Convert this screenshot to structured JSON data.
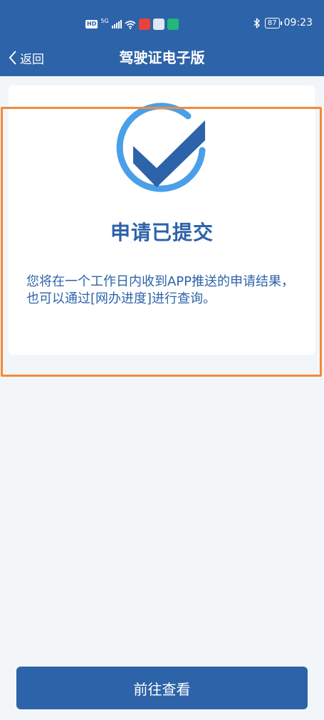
{
  "status_bar": {
    "network": "HD",
    "signal_type": "5G",
    "time": "09:23",
    "battery": "87",
    "icons": [
      "hd-icon",
      "signal-icon",
      "wifi-icon",
      "red-app-icon",
      "robot-app-icon",
      "green-app-icon",
      "bluetooth-icon",
      "battery-icon"
    ]
  },
  "header": {
    "back_label": "返回",
    "title": "驾驶证电子版"
  },
  "result": {
    "title": "申请已提交",
    "description": "您将在一个工作日内收到APP推送的申请结果，也可以通过[网办进度]进行查询。"
  },
  "footer": {
    "button_label": "前往查看"
  },
  "colors": {
    "primary": "#2d63a8",
    "check_light": "#4a9fe8",
    "highlight": "#f28a3a",
    "background": "#f3f6f8"
  }
}
